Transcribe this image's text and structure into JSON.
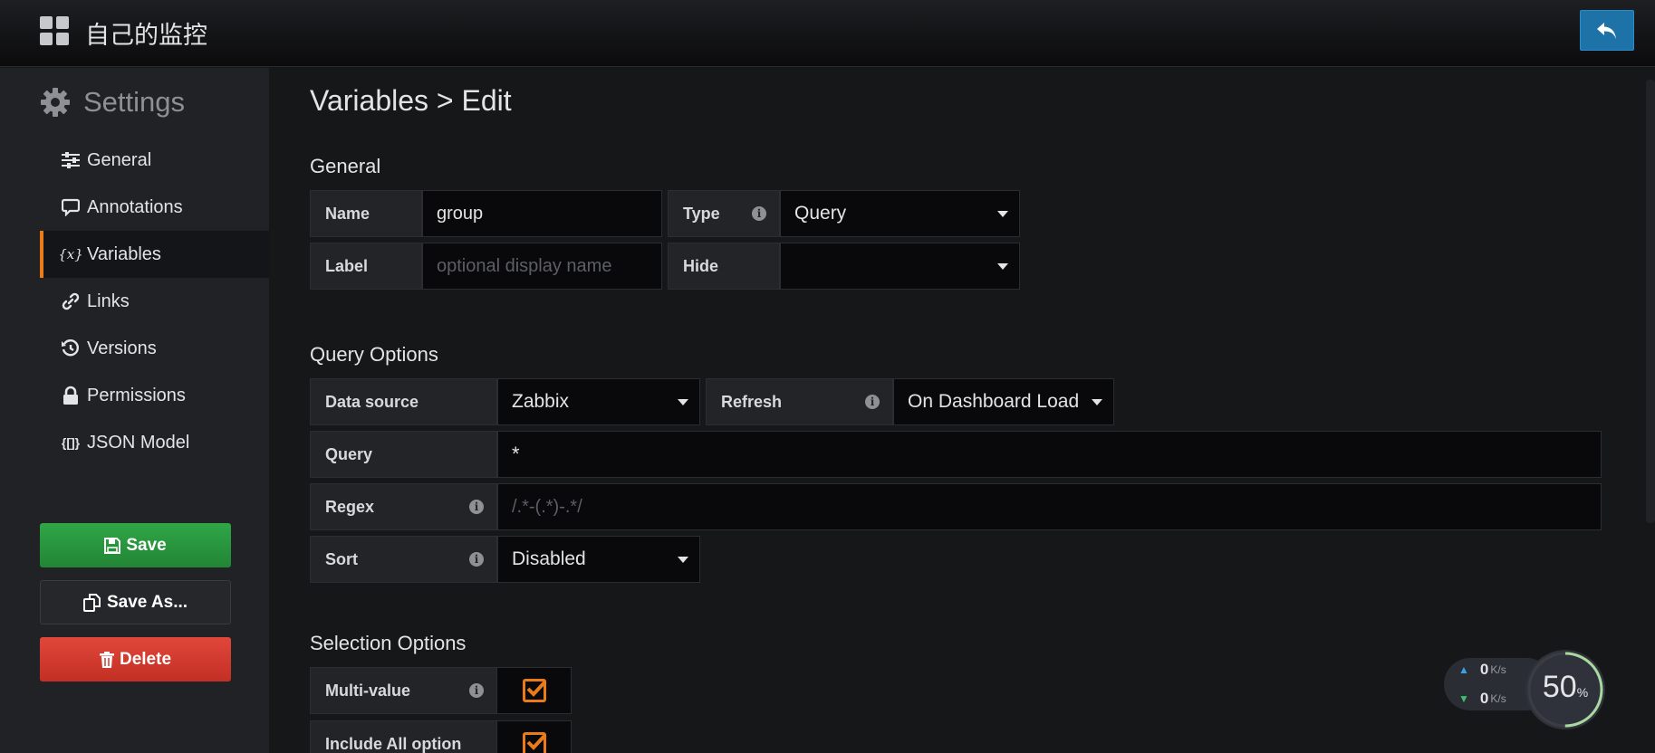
{
  "header": {
    "dashboard_title": "自己的监控",
    "back_button": "return-arrow-icon"
  },
  "sidebar": {
    "title": "Settings",
    "items": [
      {
        "label": "General",
        "icon": "sliders-icon"
      },
      {
        "label": "Annotations",
        "icon": "comment-icon"
      },
      {
        "label": "Variables",
        "icon": "variable-icon",
        "active": true
      },
      {
        "label": "Links",
        "icon": "link-icon"
      },
      {
        "label": "Versions",
        "icon": "history-icon"
      },
      {
        "label": "Permissions",
        "icon": "lock-icon"
      },
      {
        "label": "JSON Model",
        "icon": "json-icon"
      }
    ],
    "save_label": "Save",
    "save_as_label": "Save As...",
    "delete_label": "Delete"
  },
  "main": {
    "title": "Variables > Edit",
    "general": {
      "heading": "General",
      "name_label": "Name",
      "name_value": "group",
      "type_label": "Type",
      "type_value": "Query",
      "label_label": "Label",
      "label_placeholder": "optional display name",
      "hide_label": "Hide",
      "hide_value": ""
    },
    "query_options": {
      "heading": "Query Options",
      "datasource_label": "Data source",
      "datasource_value": "Zabbix",
      "refresh_label": "Refresh",
      "refresh_value": "On Dashboard Load",
      "query_label": "Query",
      "query_value": "*",
      "regex_label": "Regex",
      "regex_placeholder": "/.*-(.*)-.*/",
      "sort_label": "Sort",
      "sort_value": "Disabled"
    },
    "selection_options": {
      "heading": "Selection Options",
      "multi_value_label": "Multi-value",
      "multi_value_checked": true,
      "include_all_label": "Include All option",
      "include_all_checked": true
    }
  },
  "network_widget": {
    "upload_value": "0",
    "upload_unit": "K/s",
    "download_value": "0",
    "download_unit": "K/s",
    "percent_value": "50",
    "percent_unit": "%",
    "percent_fraction": 0.5,
    "colors": {
      "up": "#3fa0e8",
      "down": "#3cc06a",
      "ring": "#a9d8a0"
    }
  },
  "colors": {
    "accent": "#eb7b18",
    "save": "#2fa646",
    "delete": "#e0473a",
    "back": "#1d73a8"
  }
}
